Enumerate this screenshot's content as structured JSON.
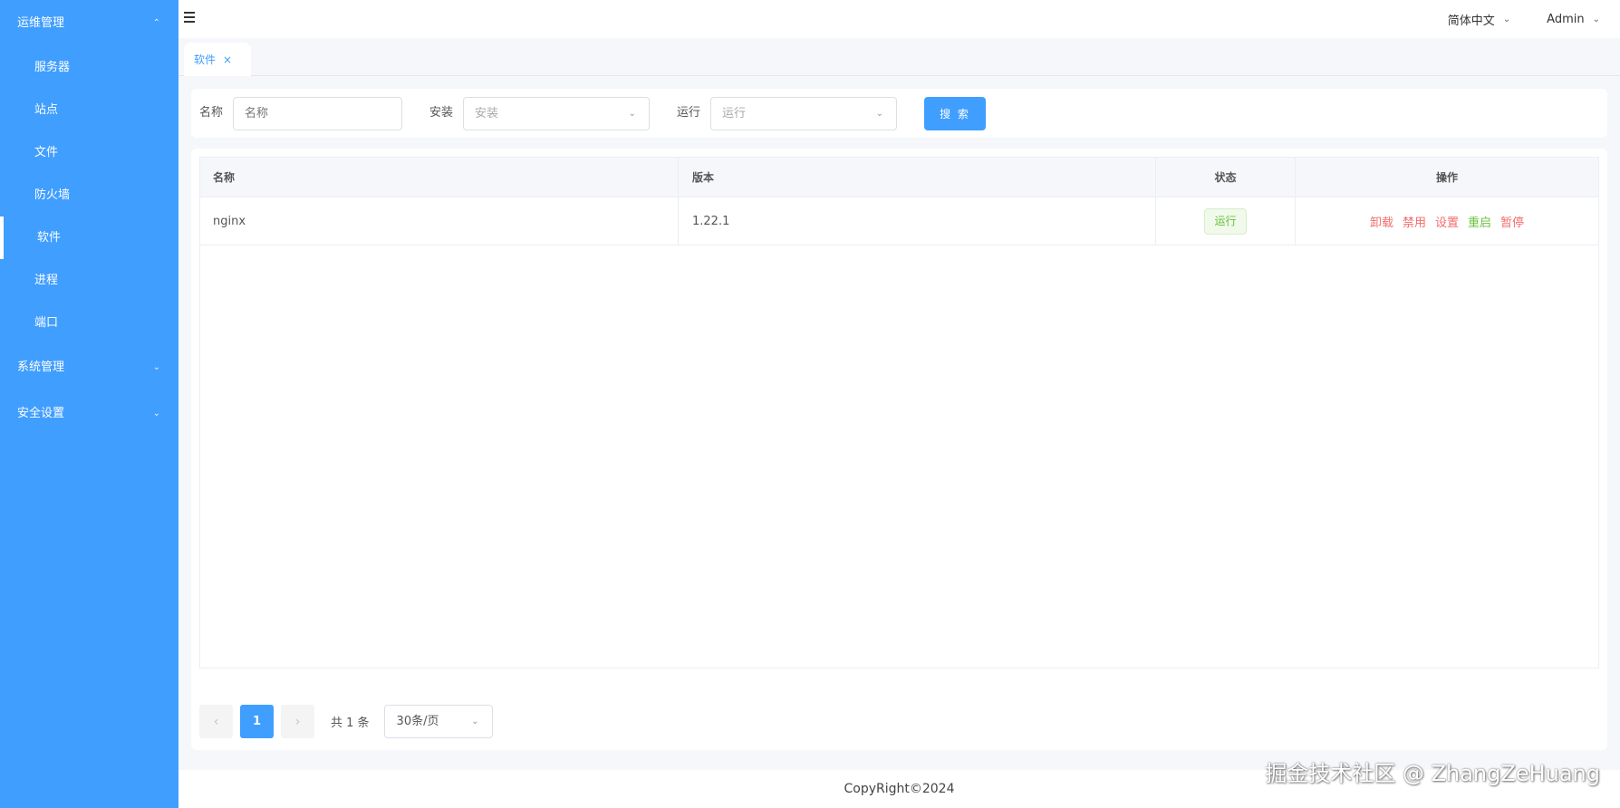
{
  "sidebar": {
    "groups": [
      {
        "title": "运维管理",
        "items": [
          {
            "label": "服务器"
          },
          {
            "label": "站点"
          },
          {
            "label": "文件"
          },
          {
            "label": "防火墙"
          },
          {
            "label": "软件",
            "active": true
          },
          {
            "label": "进程"
          },
          {
            "label": "端口"
          }
        ]
      },
      {
        "title": "系统管理"
      },
      {
        "title": "安全设置"
      }
    ]
  },
  "header": {
    "language": "简体中文",
    "user": "Admin"
  },
  "tabs": [
    {
      "label": "软件",
      "close": "×"
    }
  ],
  "search": {
    "name_label": "名称",
    "name_placeholder": "名称",
    "install_label": "安装",
    "install_placeholder": "安装",
    "run_label": "运行",
    "run_placeholder": "运行",
    "button_label": "搜 索"
  },
  "table": {
    "columns": [
      "名称",
      "版本",
      "状态",
      "操作"
    ],
    "rows": [
      {
        "name": "nginx",
        "version": "1.22.1",
        "status": "运行",
        "actions": [
          "卸载",
          "禁用",
          "设置",
          "重启",
          "暂停"
        ]
      }
    ]
  },
  "pagination": {
    "current_page": "1",
    "total": "共 1 条",
    "page_size": "30条/页"
  },
  "footer": {
    "copyright": "CopyRight©2024"
  },
  "watermark": "掘金技术社区 @ ZhangZeHuang",
  "colors": {
    "primary": "#409eff",
    "success": "#67c23a",
    "danger": "#f56c6c"
  }
}
